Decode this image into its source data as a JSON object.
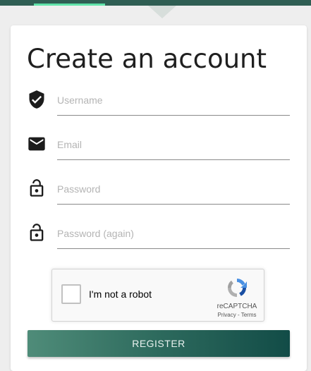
{
  "form": {
    "title": "Create an account",
    "fields": [
      {
        "icon": "shield-check-icon",
        "placeholder": "Username",
        "value": ""
      },
      {
        "icon": "email-icon",
        "placeholder": "Email",
        "value": ""
      },
      {
        "icon": "lock-open-icon",
        "placeholder": "Password",
        "value": ""
      },
      {
        "icon": "lock-open-icon",
        "placeholder": "Password (again)",
        "value": ""
      }
    ],
    "submit_label": "REGISTER"
  },
  "recaptcha": {
    "checkbox_label": "I'm not a robot",
    "checked": false,
    "brand": "reCAPTCHA",
    "legal": "Privacy - Terms",
    "icon": "recaptcha-logo-icon"
  },
  "colors": {
    "topbar": "#2f5e53",
    "tab_indicator": "#5fe3a9",
    "button_start": "#4f8c79",
    "button_end": "#124c47"
  }
}
